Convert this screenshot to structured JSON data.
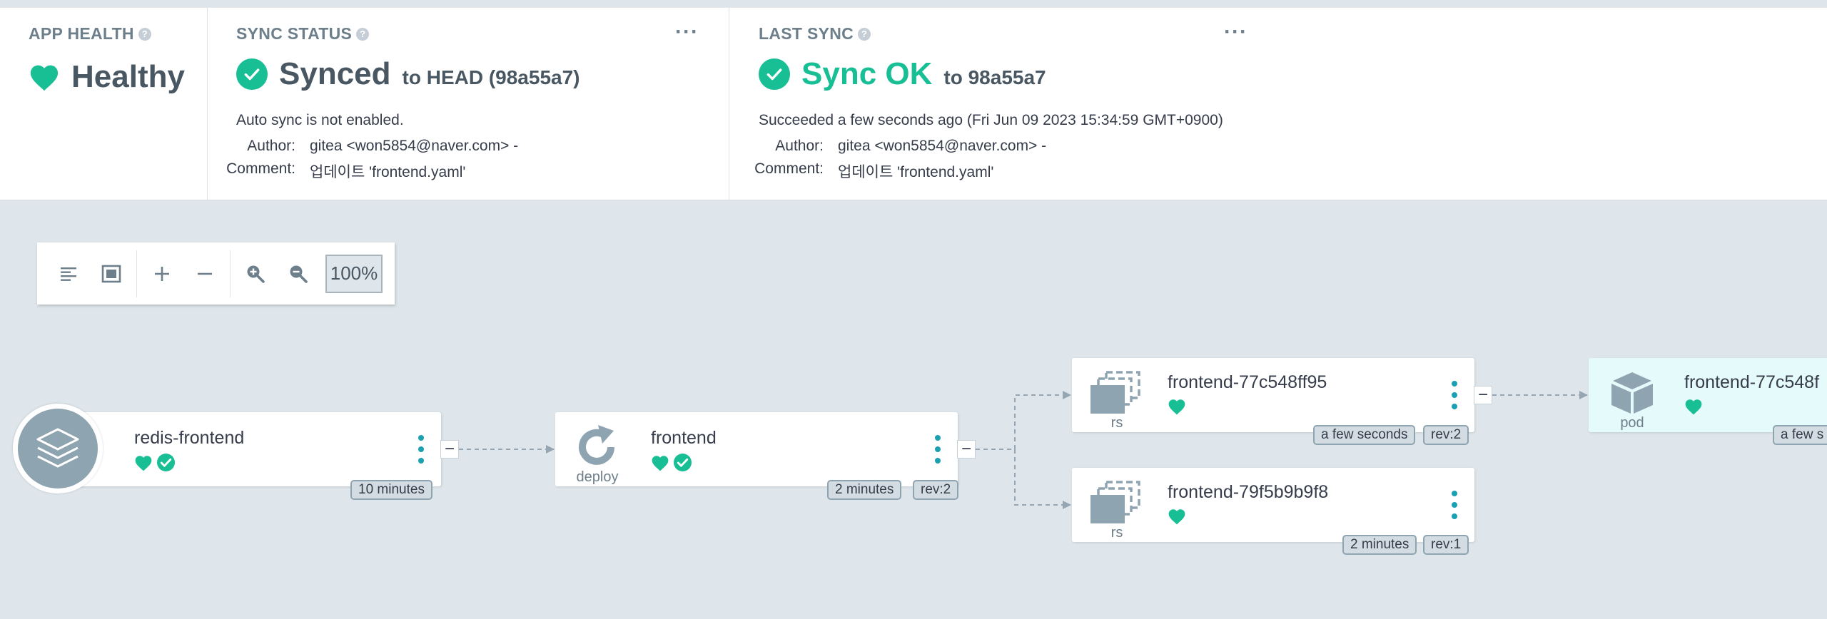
{
  "colors": {
    "healthy": "#18be94",
    "accent": "#1aa0b0",
    "canvas": "#dee6eb"
  },
  "app_health": {
    "title": "APP HEALTH",
    "status": "Healthy"
  },
  "sync_status": {
    "title": "SYNC STATUS",
    "status": "Synced",
    "target": "to HEAD (98a55a7)",
    "auto_sync": "Auto sync is not enabled.",
    "author_label": "Author:",
    "author": "gitea <won5854@naver.com> -",
    "comment_label": "Comment:",
    "comment": "업데이트 'frontend.yaml'"
  },
  "last_sync": {
    "title": "LAST SYNC",
    "status": "Sync OK",
    "target": "to 98a55a7",
    "result": "Succeeded a few seconds ago (Fri Jun 09 2023 15:34:59 GMT+0900)",
    "author_label": "Author:",
    "author": "gitea <won5854@naver.com> -",
    "comment_label": "Comment:",
    "comment": "업데이트 'frontend.yaml'"
  },
  "toolbar": {
    "zoom": "100%"
  },
  "graph": {
    "nodes": {
      "redis_frontend": {
        "name": "redis-frontend",
        "age": "10 minutes"
      },
      "frontend": {
        "name": "frontend",
        "kind": "deploy",
        "age": "2 minutes",
        "rev": "rev:2"
      },
      "rs1": {
        "name": "frontend-77c548ff95",
        "kind": "rs",
        "age": "a few seconds",
        "rev": "rev:2"
      },
      "rs2": {
        "name": "frontend-79f5b9b9f8",
        "kind": "rs",
        "age": "2 minutes",
        "rev": "rev:1"
      },
      "pod": {
        "name": "frontend-77c548f",
        "kind": "pod",
        "age": "a few s"
      }
    }
  }
}
